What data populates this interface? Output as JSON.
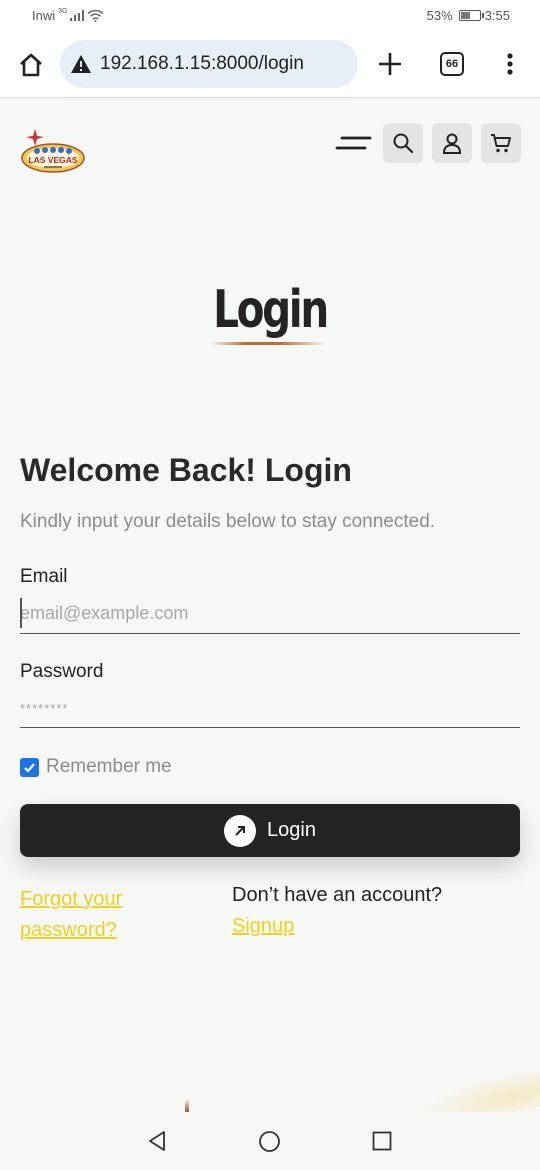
{
  "status_bar": {
    "carrier": "Inwi",
    "network": "3G",
    "battery": "53%",
    "battery_level": 0.53,
    "time": "3:55"
  },
  "browser": {
    "url": "192.168.1.15:8000/login",
    "tab_count": "66",
    "icons": [
      "home-icon",
      "warning-icon",
      "plus-icon",
      "tab-count-icon",
      "kebab-menu-icon"
    ]
  },
  "header": {
    "logo_text": "LAS VEGAS",
    "icons": [
      "hamburger-menu-icon",
      "search-icon",
      "user-icon",
      "cart-icon"
    ]
  },
  "page": {
    "title": "Login"
  },
  "form": {
    "welcome": "Welcome Back! Login",
    "subtitle": "Kindly input your details below to stay connected.",
    "email_label": "Email",
    "email_placeholder": "email@example.com",
    "password_label": "Password",
    "password_placeholder": "********",
    "remember_label": "Remember me",
    "remember_checked": true,
    "submit_label": "Login",
    "forgot_label": "Forgot your password?",
    "no_account_text": "Don’t have an account?",
    "signup_label": "Signup"
  },
  "colors": {
    "accent_link": "#f0d11a",
    "button_bg": "#262323",
    "checkbox": "#1a73e8",
    "underline": "#c86a2b"
  },
  "nav": {
    "icons": [
      "back-icon",
      "home-circle-icon",
      "recents-icon"
    ]
  }
}
